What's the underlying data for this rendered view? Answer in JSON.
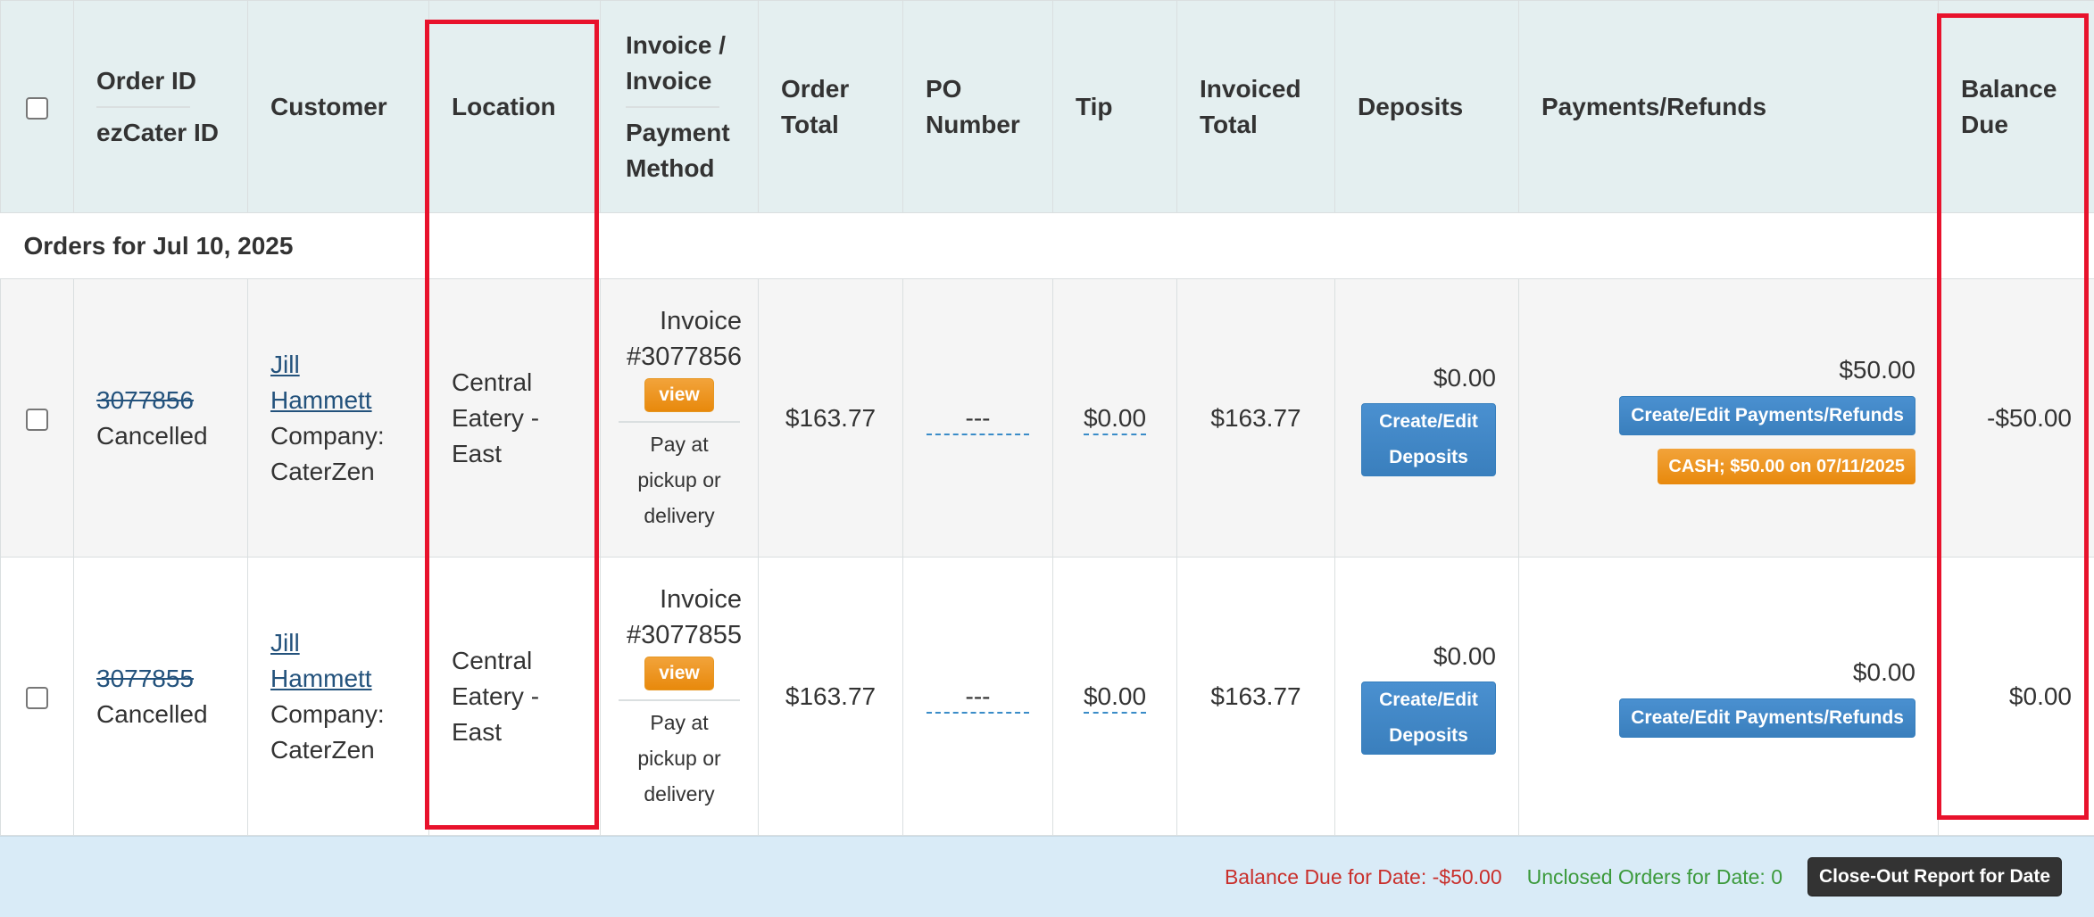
{
  "header": {
    "order_id": "Order ID",
    "ezcater_id": "ezCater ID",
    "customer": "Customer",
    "location": "Location",
    "invoice": "Invoice / Invoice",
    "payment_method": "Payment Method",
    "order_total": "Order Total",
    "po_number": "PO Number",
    "tip": "Tip",
    "invoiced_total": "Invoiced Total",
    "deposits": "Deposits",
    "payments_refunds": "Payments/Refunds",
    "balance_due": "Balance Due"
  },
  "group": {
    "label": "Orders for Jul 10, 2025"
  },
  "orders": [
    {
      "order_id": "3077856",
      "status": "Cancelled",
      "customer_name": "Jill Hammett",
      "company": "Company: CaterZen",
      "location": "Central Eatery - East",
      "invoice": "Invoice #3077856",
      "view_label": "view",
      "payment_method": "Pay at pickup or delivery",
      "order_total": "$163.77",
      "po_number": "---",
      "tip": "$0.00",
      "invoiced_total": "$163.77",
      "deposit_amount": "$0.00",
      "deposit_button": "Create/Edit Deposits",
      "payments_amount": "$50.00",
      "payments_button": "Create/Edit Payments/Refunds",
      "payment_badge": "CASH; $50.00 on 07/11/2025",
      "balance_due": "-$50.00"
    },
    {
      "order_id": "3077855",
      "status": "Cancelled",
      "customer_name": "Jill Hammett",
      "company": "Company: CaterZen",
      "location": "Central Eatery - East",
      "invoice": "Invoice #3077855",
      "view_label": "view",
      "payment_method": "Pay at pickup or delivery",
      "order_total": "$163.77",
      "po_number": "---",
      "tip": "$0.00",
      "invoiced_total": "$163.77",
      "deposit_amount": "$0.00",
      "deposit_button": "Create/Edit Deposits",
      "payments_amount": "$0.00",
      "payments_button": "Create/Edit Payments/Refunds",
      "balance_due": "$0.00"
    }
  ],
  "footer": {
    "balance_due": "Balance Due for Date: -$50.00",
    "unclosed": "Unclosed Orders for Date: 0",
    "closeout_button": "Close-Out Report for Date"
  },
  "colors": {
    "header_bg": "#e4eff0",
    "link": "#23527c",
    "button_blue": "#428bca",
    "badge_orange": "#f0ad4e",
    "footer_bg": "#d9ebf7",
    "balance_red": "#c9302c",
    "unclosed_green": "#3c9a3c",
    "highlight_red": "#e8122c"
  }
}
